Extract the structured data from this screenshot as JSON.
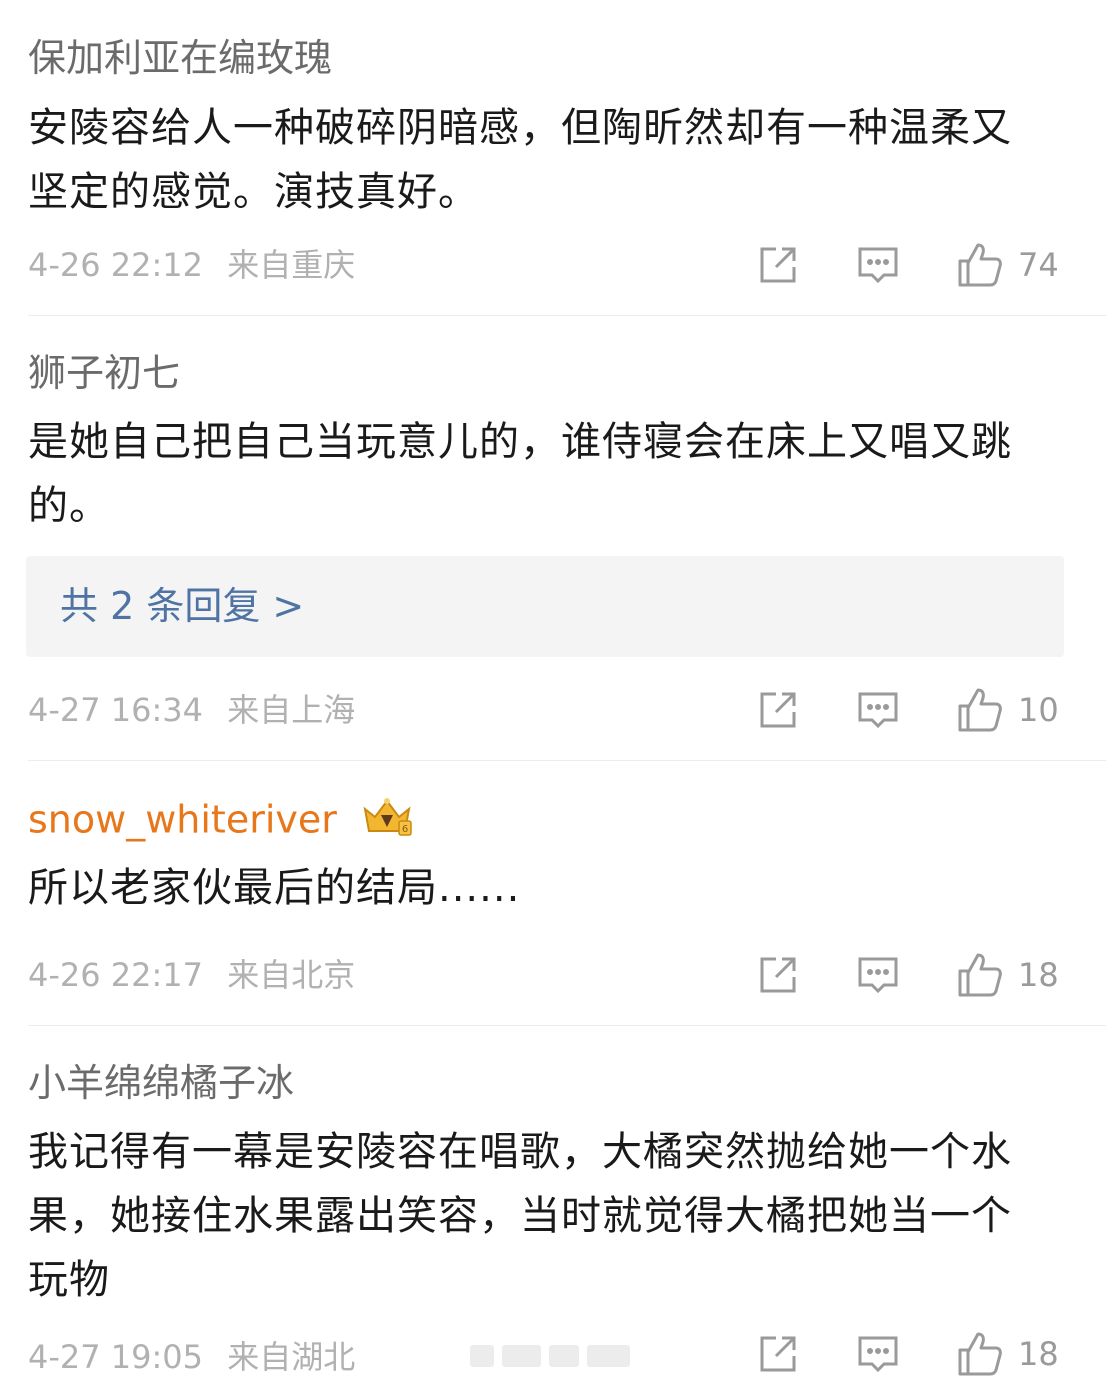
{
  "comments": [
    {
      "username": "保加利亚在编玫瑰",
      "text": "安陵容给人一种破碎阴暗感，但陶昕然却有一种温柔又坚定的感觉。演技真好。",
      "date": "4-26 22:12",
      "location": "来自重庆",
      "likes": "74"
    },
    {
      "username": "狮子初七",
      "text": "是她自己把自己当玩意儿的，谁侍寝会在床上又唱又跳的。",
      "replies_label": "共 2 条回复 >",
      "date": "4-27 16:34",
      "location": "来自上海",
      "likes": "10"
    },
    {
      "username": "snow_whiteriver",
      "text": "所以老家伙最后的结局......",
      "date": "4-26 22:17",
      "location": "来自北京",
      "likes": "18"
    },
    {
      "username": "小羊绵绵橘子冰",
      "text": "我记得有一幕是安陵容在唱歌，大橘突然抛给她一个水果，她接住水果露出笑容，当时就觉得大橘把她当一个玩物",
      "date": "4-27 19:05",
      "location": "来自湖北",
      "likes": "18"
    }
  ],
  "icons": {
    "forward": "share-square-icon",
    "reply": "comment-bubble-icon",
    "like": "thumbs-up-icon",
    "badge": "vip-crown-badge-icon"
  },
  "colors": {
    "username": "#6b6b6b",
    "vip_username": "#e8771c",
    "reply_link": "#4e73a4",
    "meta": "#b1b1b1"
  }
}
